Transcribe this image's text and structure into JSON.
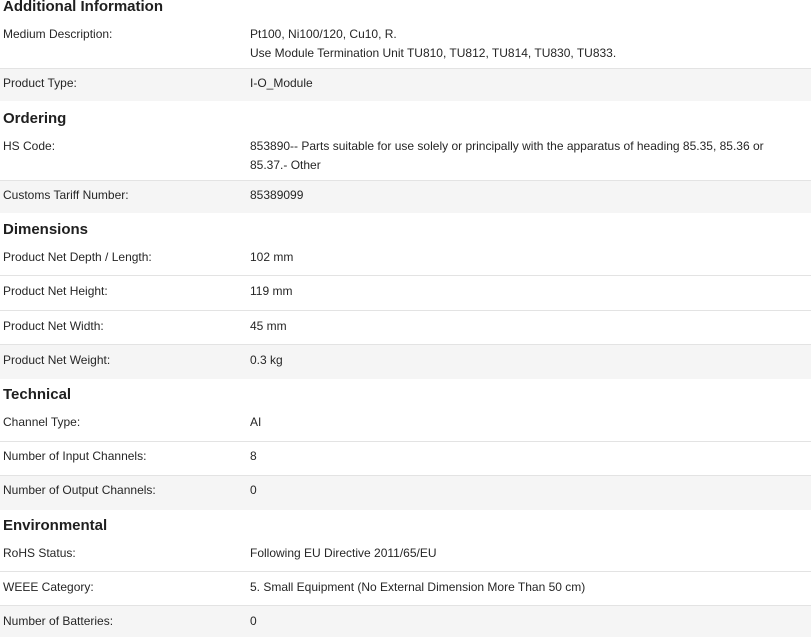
{
  "sections": {
    "additional": {
      "title": "Additional Information",
      "rows": [
        {
          "label": "Medium Description:",
          "value_lines": [
            "Pt100, Ni100/120, Cu10, R.",
            "Use Module Termination Unit TU810, TU812, TU814, TU830, TU833."
          ]
        },
        {
          "label": "Product Type:",
          "value": "I-O_Module"
        }
      ]
    },
    "ordering": {
      "title": "Ordering",
      "rows": [
        {
          "label": "HS Code:",
          "value_lines": [
            "853890-- Parts suitable for use solely or principally with the apparatus of heading 85.35, 85.36 or",
            "85.37.- Other"
          ]
        },
        {
          "label": "Customs Tariff Number:",
          "value": "85389099"
        }
      ]
    },
    "dimensions": {
      "title": "Dimensions",
      "rows": [
        {
          "label": "Product Net Depth / Length:",
          "value": "102 mm"
        },
        {
          "label": "Product Net Height:",
          "value": "119 mm"
        },
        {
          "label": "Product Net Width:",
          "value": "45 mm"
        },
        {
          "label": "Product Net Weight:",
          "value": "0.3 kg"
        }
      ]
    },
    "technical": {
      "title": "Technical",
      "rows": [
        {
          "label": "Channel Type:",
          "value": "AI"
        },
        {
          "label": "Number of Input Channels:",
          "value": "8"
        },
        {
          "label": "Number of Output Channels:",
          "value": "0"
        }
      ]
    },
    "environmental": {
      "title": "Environmental",
      "rows": [
        {
          "label": "RoHS Status:",
          "value": "Following EU Directive 2011/65/EU"
        },
        {
          "label": "WEEE Category:",
          "value": "5. Small Equipment (No External Dimension More Than 50 cm)"
        },
        {
          "label": "Number of Batteries:",
          "value": "0"
        }
      ]
    }
  }
}
